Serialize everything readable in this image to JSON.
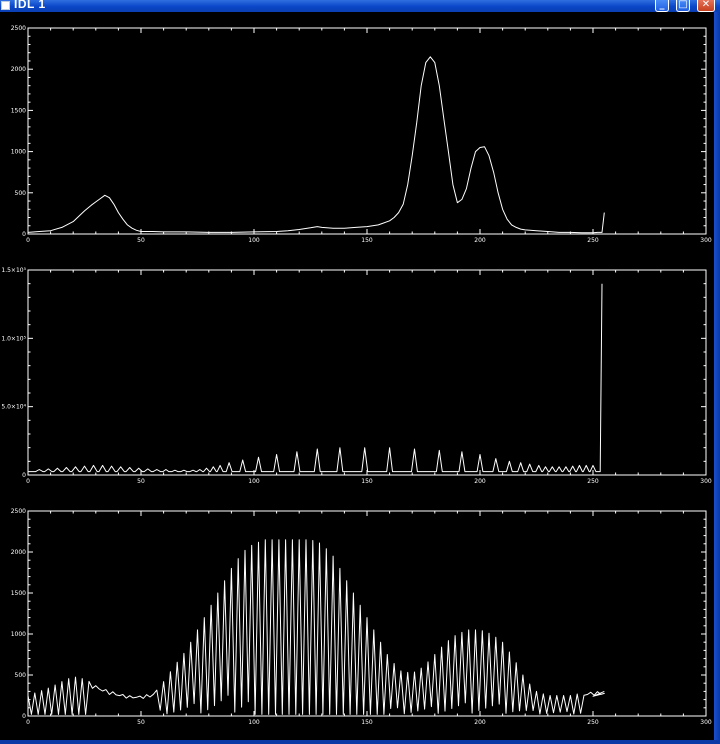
{
  "window": {
    "title": "IDL 1",
    "buttons": [
      "minimize",
      "maximize",
      "close"
    ]
  },
  "colors": {
    "background": "#000000",
    "foreground": "#ffffff",
    "titlebar": "#0a46c8"
  },
  "chart_data": [
    {
      "type": "line",
      "title": "",
      "xlabel": "",
      "ylabel": "",
      "xlim": [
        0,
        300
      ],
      "ylim": [
        0,
        2500
      ],
      "xticks": [
        "0",
        "50",
        "100",
        "150",
        "200",
        "250",
        "300"
      ],
      "yticks": [
        "0",
        "500",
        "1000",
        "1500",
        "2000",
        "2500"
      ],
      "series": [
        {
          "x": [
            0,
            5,
            10,
            15,
            20,
            25,
            28,
            30,
            32,
            34,
            36,
            38,
            40,
            42,
            44,
            46,
            48,
            50,
            55,
            60,
            70,
            80,
            90,
            100,
            110,
            115,
            120,
            125,
            128,
            130,
            135,
            140,
            145,
            150,
            155,
            160,
            162,
            164,
            166,
            168,
            170,
            172,
            174,
            176,
            178,
            180,
            182,
            184,
            186,
            188,
            190,
            192,
            194,
            196,
            198,
            200,
            202,
            204,
            206,
            208,
            210,
            212,
            214,
            216,
            218,
            220,
            225,
            230,
            235,
            240,
            245,
            250,
            252,
            254,
            255
          ],
          "y": [
            20,
            30,
            40,
            80,
            150,
            280,
            350,
            390,
            430,
            470,
            440,
            360,
            260,
            180,
            110,
            70,
            45,
            30,
            30,
            25,
            25,
            20,
            20,
            25,
            30,
            40,
            55,
            75,
            90,
            80,
            70,
            70,
            80,
            90,
            110,
            160,
            200,
            260,
            360,
            600,
            950,
            1350,
            1800,
            2080,
            2150,
            2080,
            1800,
            1400,
            1000,
            600,
            380,
            420,
            550,
            800,
            1000,
            1050,
            1060,
            950,
            750,
            500,
            300,
            180,
            110,
            80,
            60,
            50,
            40,
            30,
            20,
            20,
            15,
            15,
            20,
            20,
            260
          ]
        }
      ]
    },
    {
      "type": "line",
      "title": "",
      "xlabel": "",
      "ylabel": "",
      "xlim": [
        0,
        300
      ],
      "ylim": [
        0,
        150000
      ],
      "xticks": [
        "0",
        "50",
        "100",
        "150",
        "200",
        "250",
        "300"
      ],
      "yticks": [
        "0",
        "5.0×10⁴",
        "1.0×10⁵",
        "1.5×10⁵"
      ],
      "series": [
        {
          "baseline": 2500,
          "spikes": [
            {
              "x": 5,
              "y": 4000
            },
            {
              "x": 9,
              "y": 4500
            },
            {
              "x": 13,
              "y": 5000
            },
            {
              "x": 17,
              "y": 5500
            },
            {
              "x": 21,
              "y": 6000
            },
            {
              "x": 25,
              "y": 6500
            },
            {
              "x": 29,
              "y": 7000
            },
            {
              "x": 33,
              "y": 7000
            },
            {
              "x": 37,
              "y": 6500
            },
            {
              "x": 41,
              "y": 6000
            },
            {
              "x": 45,
              "y": 5500
            },
            {
              "x": 49,
              "y": 5000
            },
            {
              "x": 53,
              "y": 4500
            },
            {
              "x": 57,
              "y": 4000
            },
            {
              "x": 61,
              "y": 4000
            },
            {
              "x": 65,
              "y": 3500
            },
            {
              "x": 69,
              "y": 3500
            },
            {
              "x": 73,
              "y": 3500
            },
            {
              "x": 76,
              "y": 4000
            },
            {
              "x": 79,
              "y": 5000
            },
            {
              "x": 82,
              "y": 6000
            },
            {
              "x": 85,
              "y": 7000
            },
            {
              "x": 89,
              "y": 9000
            },
            {
              "x": 95,
              "y": 11000
            },
            {
              "x": 102,
              "y": 13000
            },
            {
              "x": 110,
              "y": 15000
            },
            {
              "x": 119,
              "y": 17000
            },
            {
              "x": 128,
              "y": 19000
            },
            {
              "x": 138,
              "y": 20000
            },
            {
              "x": 149,
              "y": 20000
            },
            {
              "x": 160,
              "y": 20000
            },
            {
              "x": 171,
              "y": 19000
            },
            {
              "x": 182,
              "y": 18000
            },
            {
              "x": 192,
              "y": 17000
            },
            {
              "x": 200,
              "y": 15000
            },
            {
              "x": 207,
              "y": 12000
            },
            {
              "x": 213,
              "y": 10000
            },
            {
              "x": 218,
              "y": 9000
            },
            {
              "x": 222,
              "y": 8000
            },
            {
              "x": 226,
              "y": 7000
            },
            {
              "x": 229,
              "y": 6000
            },
            {
              "x": 232,
              "y": 6000
            },
            {
              "x": 235,
              "y": 6000
            },
            {
              "x": 238,
              "y": 6000
            },
            {
              "x": 241,
              "y": 6500
            },
            {
              "x": 244,
              "y": 7000
            },
            {
              "x": 247,
              "y": 7000
            },
            {
              "x": 250,
              "y": 7000
            }
          ],
          "final_spike": {
            "x": 254,
            "y": 140000
          }
        }
      ]
    },
    {
      "type": "line",
      "title": "",
      "xlabel": "",
      "ylabel": "",
      "xlim": [
        0,
        300
      ],
      "ylim": [
        0,
        2500
      ],
      "xticks": [
        "0",
        "50",
        "100",
        "150",
        "200",
        "250",
        "300"
      ],
      "yticks": [
        "0",
        "500",
        "1000",
        "1500",
        "2000",
        "2500"
      ],
      "series": [
        {
          "envelope_x": [
            0,
            5,
            10,
            15,
            20,
            25,
            30,
            35,
            40,
            45,
            50,
            55,
            60,
            65,
            70,
            75,
            80,
            85,
            90,
            95,
            100,
            105,
            110,
            115,
            120,
            125,
            130,
            135,
            140,
            145,
            150,
            155,
            160,
            165,
            170,
            175,
            180,
            185,
            190,
            195,
            200,
            205,
            210,
            215,
            220,
            225,
            230,
            235,
            240,
            245,
            250,
            255
          ],
          "envelope_y": [
            250,
            300,
            350,
            420,
            480,
            450,
            380,
            320,
            280,
            250,
            250,
            270,
            420,
            620,
            800,
            1050,
            1300,
            1550,
            1800,
            2000,
            2100,
            2150,
            2150,
            2150,
            2150,
            2150,
            2100,
            1950,
            1700,
            1450,
            1200,
            950,
            700,
            550,
            520,
            600,
            750,
            900,
            1000,
            1050,
            1050,
            1000,
            900,
            700,
            450,
            300,
            250,
            250,
            250,
            280,
            300,
            300
          ],
          "floor_y": 20,
          "tail_y": 300
        }
      ]
    }
  ]
}
